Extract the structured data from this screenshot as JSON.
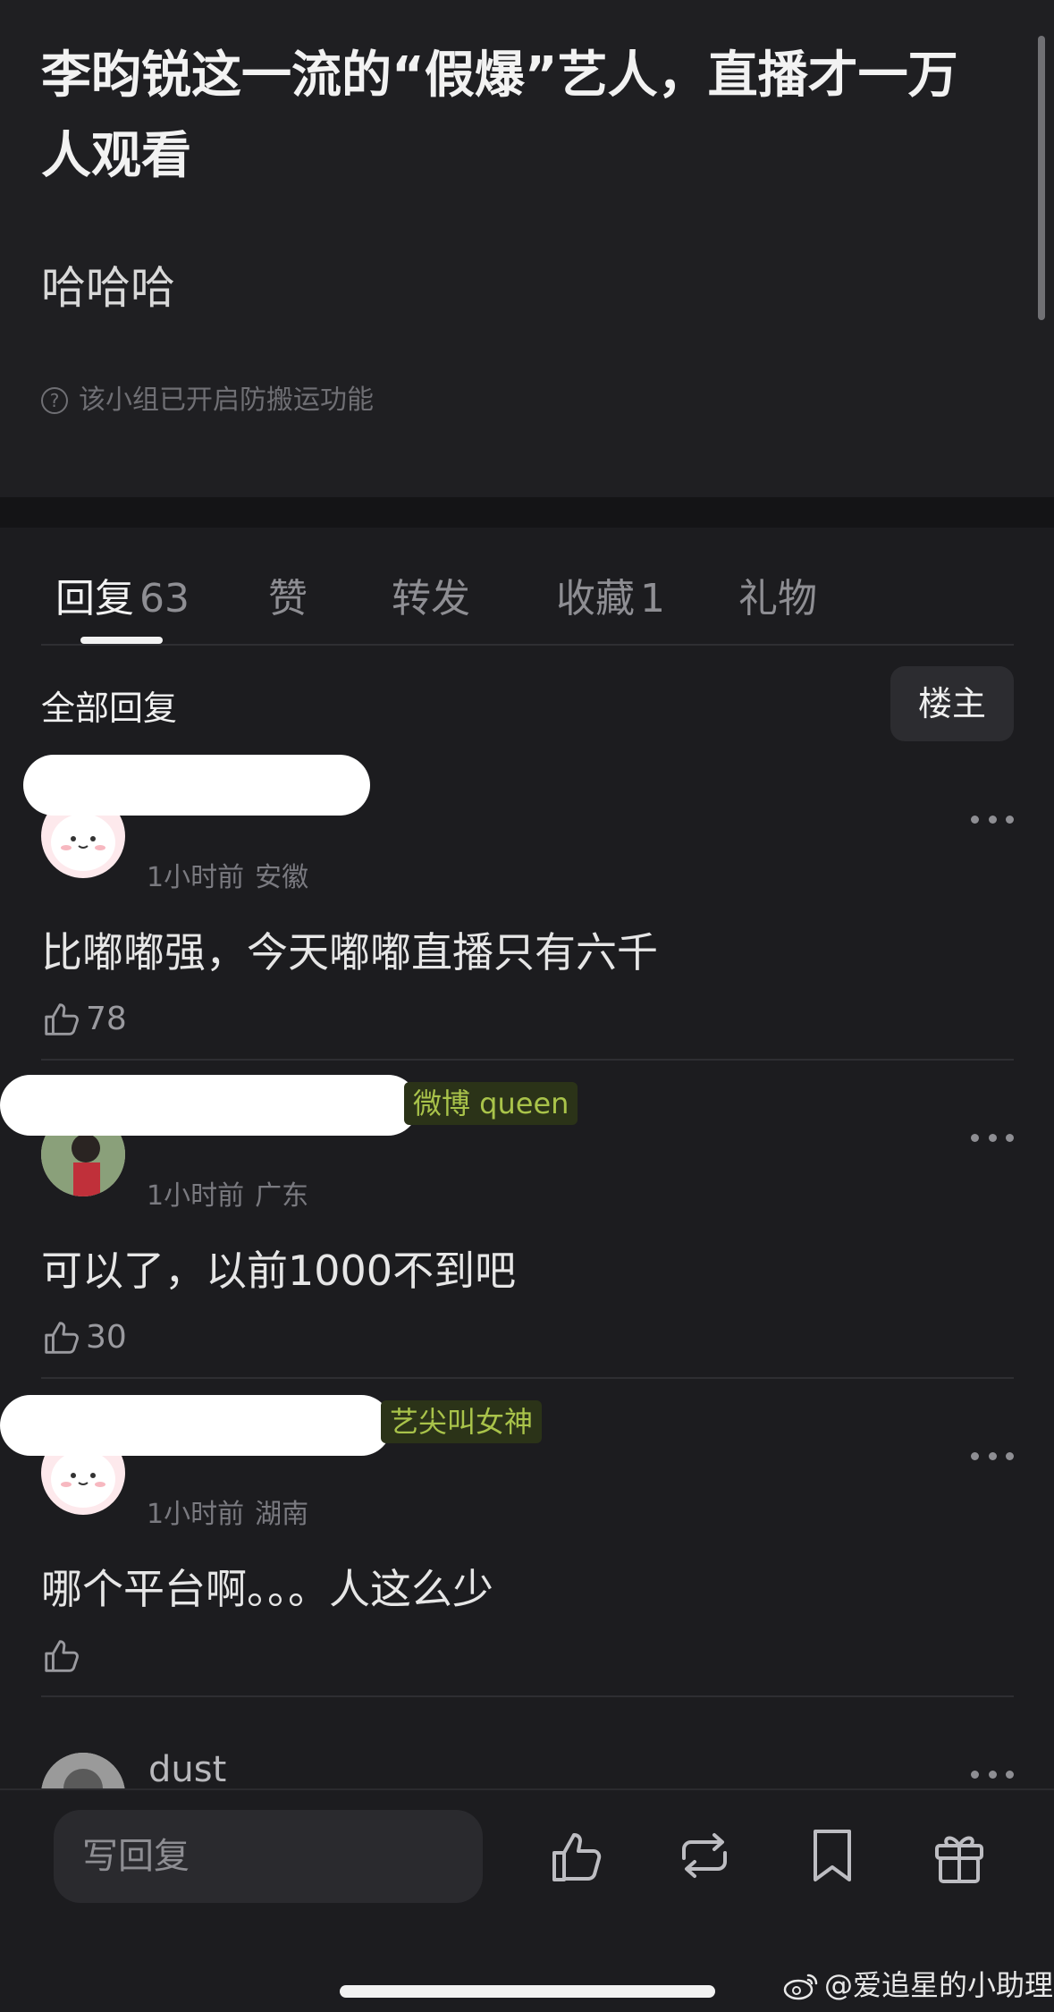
{
  "post": {
    "title": "李昀锐这一流的“假爆”艺人，直播才一万人观看",
    "body": "哈哈哈",
    "notice": "该小组已开启防搬运功能"
  },
  "tabs": [
    {
      "label": "回复",
      "count": "63"
    },
    {
      "label": "赞",
      "count": ""
    },
    {
      "label": "转发",
      "count": ""
    },
    {
      "label": "收藏",
      "count": "1"
    },
    {
      "label": "礼物",
      "count": ""
    }
  ],
  "filter": {
    "label": "全部回复",
    "button": "楼主"
  },
  "comments": [
    {
      "username": "",
      "badge": "",
      "time": "1小时前",
      "location": "安徽",
      "text": "比嘟嘟强，今天嘟嘟直播只有六千",
      "likes": "78"
    },
    {
      "username": "",
      "badge": "微博 queen",
      "time": "1小时前",
      "location": "广东",
      "text": "可以了，以前1000不到吧",
      "likes": "30"
    },
    {
      "username": "",
      "badge": "艺尖叫女神",
      "time": "1小时前",
      "location": "湖南",
      "text": "哪个平台啊。。。人这么少",
      "likes": ""
    },
    {
      "username": "dust"
    }
  ],
  "bottom_bar": {
    "reply_placeholder": "写回复",
    "icons": [
      "like-icon",
      "repost-icon",
      "bookmark-icon",
      "gift-icon"
    ]
  },
  "watermark": "@爱追星的小助理",
  "colors": {
    "background": "#1c1c1f",
    "badge_text": "#a9c34a",
    "badge_bg": "#2b3318"
  }
}
